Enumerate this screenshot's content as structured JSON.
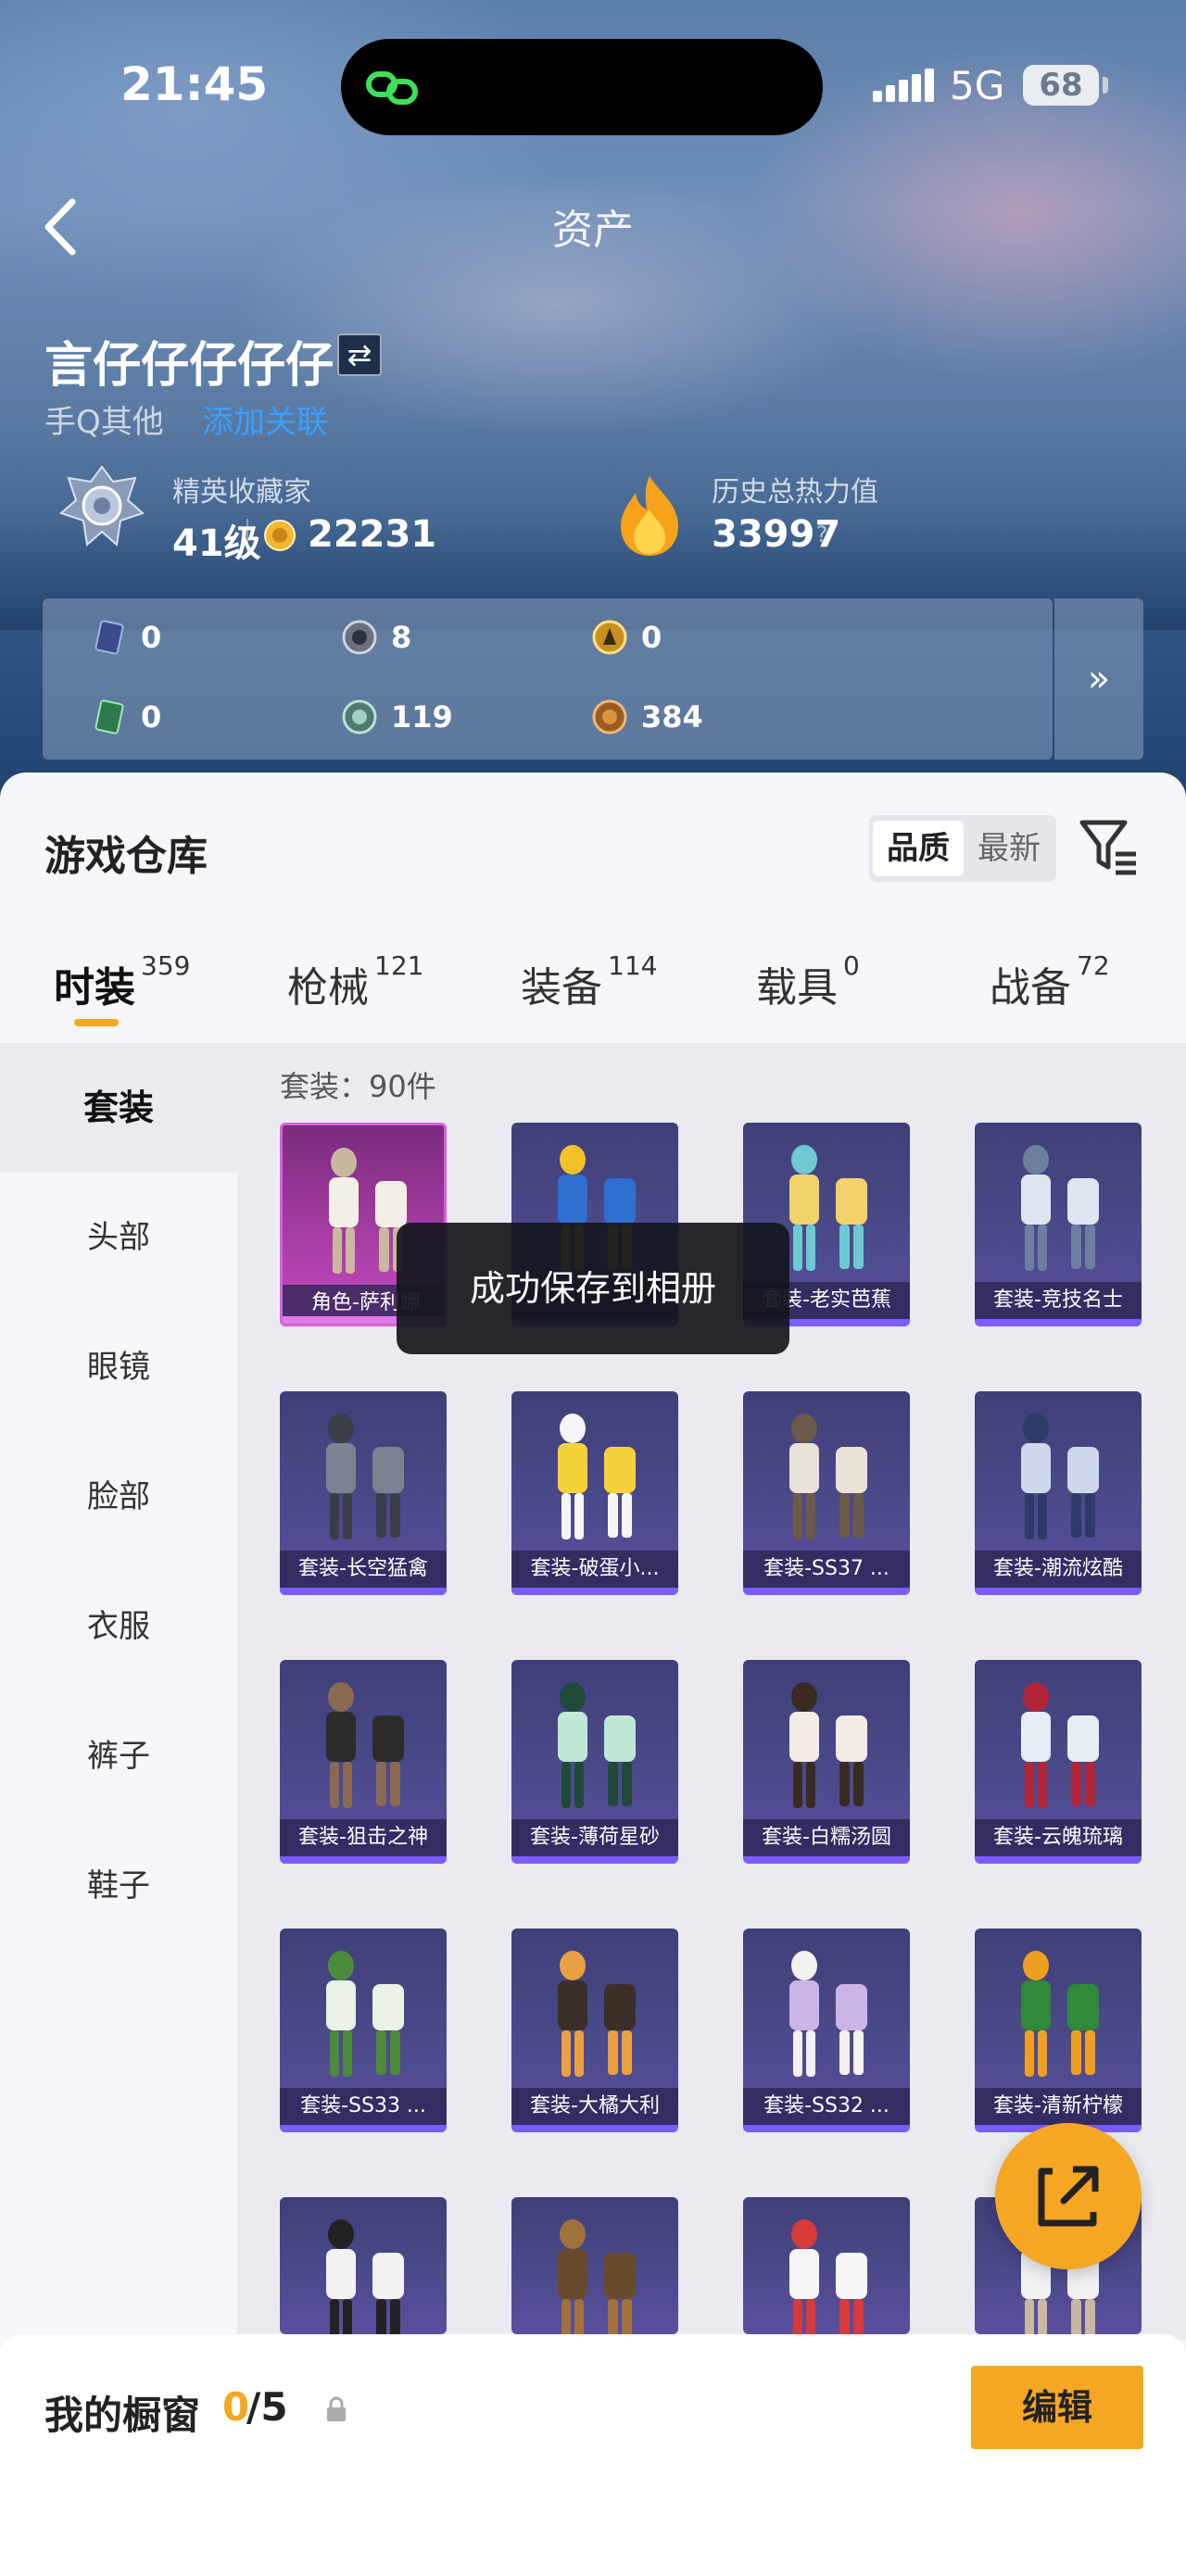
{
  "status_bar": {
    "time": "21:45",
    "network": "5G",
    "battery": "68"
  },
  "nav": {
    "title": "资产",
    "back_icon": "chevron-left-icon"
  },
  "profile": {
    "username": "言仔仔仔仔仔",
    "swap_icon": "swap-icon",
    "platform": "手Q其他",
    "platform_link": "添加关联",
    "rank_title": "精英收藏家",
    "rank_level": "41级",
    "rank_points": "22231",
    "heat_title": "历史总热力值",
    "heat_value": "33997",
    "help_glyph": "?"
  },
  "currencies": [
    {
      "icon": "card-blue-icon",
      "value": "0"
    },
    {
      "icon": "coin-grey-icon",
      "value": "8"
    },
    {
      "icon": "coin-gold-icon",
      "value": "0"
    },
    {
      "icon": "card-green-icon",
      "value": "0"
    },
    {
      "icon": "coin-teal-icon",
      "value": "119"
    },
    {
      "icon": "coin-bronze-icon",
      "value": "384"
    }
  ],
  "currency_more": "»",
  "warehouse": {
    "title": "游戏仓库",
    "sort_options": [
      "品质",
      "最新"
    ],
    "tabs": [
      {
        "label": "时装",
        "count": "359"
      },
      {
        "label": "枪械",
        "count": "121"
      },
      {
        "label": "装备",
        "count": "114"
      },
      {
        "label": "载具",
        "count": "0"
      },
      {
        "label": "战备",
        "count": "72"
      }
    ],
    "categories": [
      "套装",
      "头部",
      "眼镜",
      "脸部",
      "衣服",
      "裤子",
      "鞋子"
    ],
    "count_label": "套装：90件",
    "items": [
      "角色-萨利娜",
      "",
      "套装-老实芭蕉",
      "套装-竞技名士",
      "套装-长空猛禽",
      "套装-破蛋小...",
      "套装-SS37 ...",
      "套装-潮流炫酷",
      "套装-狙击之神",
      "套装-薄荷星砂",
      "套装-白糯汤圆",
      "套装-云魄琉璃",
      "套装-SS33 ...",
      "套装-大橘大利",
      "套装-SS32 ...",
      "套装-清新柠檬",
      "",
      "",
      "",
      ""
    ]
  },
  "toast": "成功保存到相册",
  "fab_icon": "share-icon",
  "showcase": {
    "label": "我的橱窗",
    "used": "0",
    "total": "/5",
    "lock_icon": "lock-icon",
    "edit_label": "编辑"
  },
  "colors": {
    "accent": "#f5a623",
    "card": "#4b4a8a",
    "legendary": "#c24bc0"
  }
}
